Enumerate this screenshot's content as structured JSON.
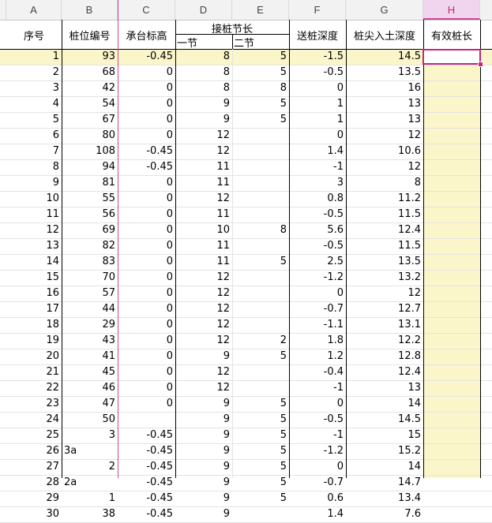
{
  "columns": [
    "",
    "A",
    "B",
    "C",
    "D",
    "E",
    "F",
    "G",
    "H"
  ],
  "header": {
    "seq": "序号",
    "pile_no": "桩位编号",
    "cap_elev": "承台标高",
    "joint_length": "接桩节长",
    "section1": "一节",
    "section2": "二节",
    "send_depth": "送桩深度",
    "tip_depth": "桩尖入土深度",
    "effective_length": "有效桩长"
  },
  "rows": [
    [
      "1",
      "93",
      "-0.45",
      "8",
      "5",
      "-1.5",
      "14.5"
    ],
    [
      "2",
      "68",
      "0",
      "8",
      "5",
      "-0.5",
      "13.5"
    ],
    [
      "3",
      "42",
      "0",
      "8",
      "8",
      "0",
      "16"
    ],
    [
      "4",
      "54",
      "0",
      "9",
      "5",
      "1",
      "13"
    ],
    [
      "5",
      "67",
      "0",
      "9",
      "5",
      "1",
      "13"
    ],
    [
      "6",
      "80",
      "0",
      "12",
      "",
      "0",
      "12"
    ],
    [
      "7",
      "108",
      "-0.45",
      "12",
      "",
      "1.4",
      "10.6"
    ],
    [
      "8",
      "94",
      "-0.45",
      "11",
      "",
      "-1",
      "12"
    ],
    [
      "9",
      "81",
      "0",
      "11",
      "",
      "3",
      "8"
    ],
    [
      "10",
      "55",
      "0",
      "12",
      "",
      "0.8",
      "11.2"
    ],
    [
      "11",
      "56",
      "0",
      "11",
      "",
      "-0.5",
      "11.5"
    ],
    [
      "12",
      "69",
      "0",
      "10",
      "8",
      "5.6",
      "12.4"
    ],
    [
      "13",
      "82",
      "0",
      "11",
      "",
      "-0.5",
      "11.5"
    ],
    [
      "14",
      "83",
      "0",
      "11",
      "5",
      "2.5",
      "13.5"
    ],
    [
      "15",
      "70",
      "0",
      "12",
      "",
      "-1.2",
      "13.2"
    ],
    [
      "16",
      "57",
      "0",
      "12",
      "",
      "0",
      "12"
    ],
    [
      "17",
      "44",
      "0",
      "12",
      "",
      "-0.7",
      "12.7"
    ],
    [
      "18",
      "29",
      "0",
      "12",
      "",
      "-1.1",
      "13.1"
    ],
    [
      "19",
      "43",
      "0",
      "12",
      "2",
      "1.8",
      "12.2"
    ],
    [
      "20",
      "41",
      "0",
      "9",
      "5",
      "1.2",
      "12.8"
    ],
    [
      "21",
      "45",
      "0",
      "12",
      "",
      "-0.4",
      "12.4"
    ],
    [
      "22",
      "46",
      "0",
      "12",
      "",
      "-1",
      "13"
    ],
    [
      "23",
      "47",
      "0",
      "9",
      "5",
      "0",
      "14"
    ],
    [
      "24",
      "50",
      "",
      "9",
      "5",
      "-0.5",
      "14.5"
    ],
    [
      "25",
      "3",
      "-0.45",
      "9",
      "5",
      "-1",
      "15"
    ],
    [
      "26",
      "3a",
      "-0.45",
      "9",
      "5",
      "-1.2",
      "15.2"
    ],
    [
      "27",
      "2",
      "-0.45",
      "9",
      "5",
      "0",
      "14"
    ],
    [
      "28",
      "2a",
      "-0.45",
      "9",
      "5",
      "-0.7",
      "14.7"
    ],
    [
      "29",
      "1",
      "-0.45",
      "9",
      "5",
      "0.6",
      "13.4"
    ],
    [
      "30",
      "38",
      "-0.45",
      "9",
      "",
      "1.4",
      "7.6"
    ]
  ]
}
